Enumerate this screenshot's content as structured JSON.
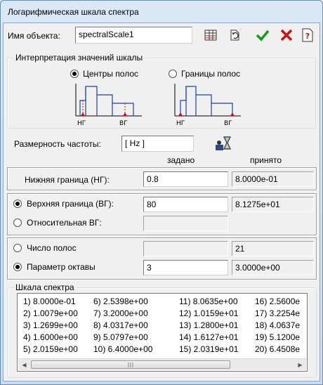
{
  "window": {
    "title": "Логарифмическая шкала спектра"
  },
  "object_name": {
    "label": "Имя объекта:",
    "value": "spectralScale1"
  },
  "interpretation": {
    "legend": "Интерпретация значений шкалы",
    "centers_label": "Центры полос",
    "boundaries_label": "Границы полос",
    "selected": "centers",
    "diagram_low": "НГ",
    "diagram_high": "ВГ"
  },
  "frequency_unit": {
    "label": "Размерность частоты:",
    "value": "[ Hz ]"
  },
  "columns": {
    "given": "задано",
    "accepted": "принято"
  },
  "lower_bound": {
    "label": "Нижняя граница (НГ):",
    "given": "0.8",
    "accepted": "8.0000e-01"
  },
  "upper_bound": {
    "label": "Верхняя граница (ВГ):",
    "given": "80",
    "accepted": "8.1275e+01",
    "selected": true
  },
  "relative_upper": {
    "label": "Относительная ВГ:",
    "given": "",
    "accepted": "",
    "selected": false
  },
  "band_count": {
    "label": "Число полос",
    "given": "",
    "accepted": "21",
    "selected": false
  },
  "octave_param": {
    "label": "Параметр октавы",
    "given": "3",
    "accepted": "3.0000e+00",
    "selected": true
  },
  "spectrum": {
    "legend": "Шкала спектра",
    "rows": [
      [
        "1) 8.0000e-01",
        "6) 2.5398e+00",
        "11) 8.0635e+00",
        "16) 2.5600e"
      ],
      [
        "2) 1.0079e+00",
        "7) 3.2000e+00",
        "12) 1.0159e+01",
        "17) 3.2254e"
      ],
      [
        "3) 1.2699e+00",
        "8) 4.0317e+00",
        "13) 1.2800e+01",
        "18) 4.0637e"
      ],
      [
        "4) 1.6000e+00",
        "9) 5.0797e+00",
        "14) 1.6127e+01",
        "19) 5.1200e"
      ],
      [
        "5) 2.0159e+00",
        "10) 6.4000e+00",
        "15) 2.0319e+01",
        "20) 6.4508e"
      ]
    ]
  },
  "toolbar": {
    "icons": [
      "table-icon",
      "reset-icon",
      "ok-check-icon",
      "cancel-x-icon",
      "help-icon"
    ]
  },
  "colors": {
    "accent_blue": "#1a3fa0",
    "marker_red": "#d01010",
    "ok_green": "#1a9a1a"
  }
}
